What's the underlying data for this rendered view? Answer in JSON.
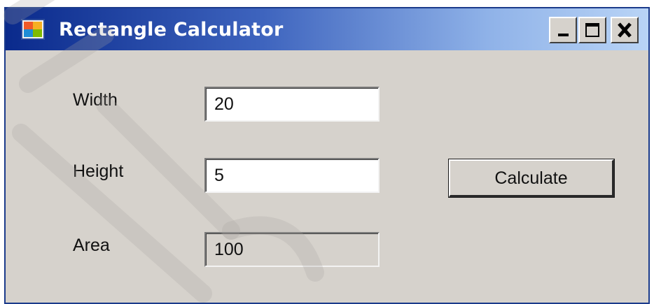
{
  "window": {
    "title": "Rectangle Calculator",
    "controls": {
      "minimize": "minimize-icon",
      "maximize": "maximize-icon",
      "close": "close-icon"
    }
  },
  "form": {
    "width_label": "Width",
    "width_value": "20",
    "height_label": "Height",
    "height_value": "5",
    "area_label": "Area",
    "area_value": "100",
    "calculate_label": "Calculate"
  },
  "colors": {
    "titlebar_start": "#0a2a8c",
    "titlebar_end": "#b9d4f6",
    "window_background": "#d6d2cc",
    "textbox_background": "#ffffff"
  }
}
